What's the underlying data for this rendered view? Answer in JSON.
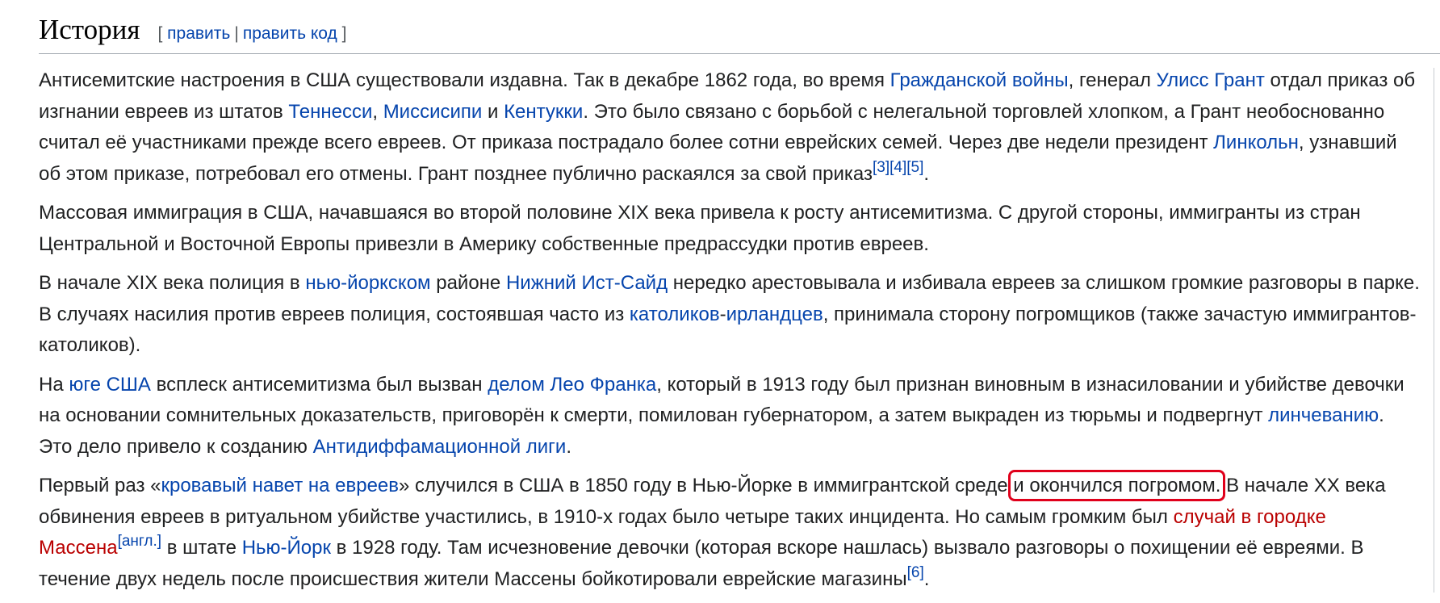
{
  "section": {
    "title": "История",
    "edit_open": "[",
    "edit_label": "править",
    "edit_sep": "|",
    "edit_code_label": "править код",
    "edit_close": "]"
  },
  "paragraphs": [
    {
      "t0": "Антисемитские настроения в США существовали издавна. Так в декабре 1862 года, во время ",
      "l0": "Гражданской войны",
      "t1": ", генерал ",
      "l1": "Улисс Грант",
      "t2": " отдал приказ об изгнании евреев из штатов ",
      "l2": "Теннесси",
      "t3": ", ",
      "l3": "Миссисипи",
      "t4": " и ",
      "l4": "Кентукки",
      "t5": ". Это было связано с борьбой с нелегальной торговлей хлопком, а Грант необоснованно считал её участниками прежде всего евреев. От приказа пострадало более сотни еврейских семей. Через две недели президент ",
      "l5": "Линкольн",
      "t6": ", узнавший об этом приказе, потребовал его отмены. Грант позднее публично раскаялся за свой приказ",
      "r0": "[3]",
      "r1": "[4]",
      "r2": "[5]",
      "t7": "."
    },
    {
      "t0": "Массовая иммиграция в США, начавшаяся во второй половине XIX века привела к росту антисемитизма. С другой стороны, иммигранты из стран Центральной и Восточной Европы привезли в Америку собственные предрассудки против евреев."
    },
    {
      "t0": "В начале XIX века полиция в ",
      "l0": "нью-йоркском",
      "t1": " районе ",
      "l1": "Нижний Ист-Сайд",
      "t2": " нередко арестовывала и избивала евреев за слишком громкие разговоры в парке. В случаях насилия против евреев полиция, состоявшая часто из ",
      "l2": "католиков",
      "t3": "-",
      "l3": "ирландцев",
      "t4": ", принимала сторону погромщиков (также зачастую иммигрантов-католиков)."
    },
    {
      "t0": "На ",
      "l0": "юге США",
      "t1": " всплеск антисемитизма был вызван ",
      "l1": "делом Лео Франка",
      "t2": ", который в 1913 году был признан виновным в изнасиловании и убийстве девочки на основании сомнительных доказательств, приговорён к смерти, помилован губернатором, а затем выкраден из тюрьмы и подвергнут ",
      "l2": "линчеванию",
      "t3": ". Это дело привело к созданию ",
      "l3": "Антидиффамационной лиги",
      "t4": "."
    },
    {
      "t0": "Первый раз «",
      "l0": "кровавый навет на евреев",
      "t1": "» случился в США в 1850 году в Нью-Йорке в иммигрантской среде ",
      "hl": "и окончился погромом.",
      "t2": " В начале XX века обвинения евреев в ритуальном убийстве участились, в 1910-х годах было четыре таких инцидента. Но самым громким был ",
      "rl0": "случай в городке Массена",
      "r0": "[англ.]",
      "t3": " в штате ",
      "l1": "Нью-Йорк",
      "t4": " в 1928 году. Там исчезновение девочки (которая вскоре нашлась) вызвало разговоры о похищении её евреями. В течение двух недель после происшествия жители Массены бойкотировали еврейские магазины",
      "r1": "[6]",
      "t5": "."
    }
  ],
  "colors": {
    "link": "#0645ad",
    "redlink": "#ba0000",
    "text": "#202122",
    "highlight_box": "#e0001b"
  }
}
